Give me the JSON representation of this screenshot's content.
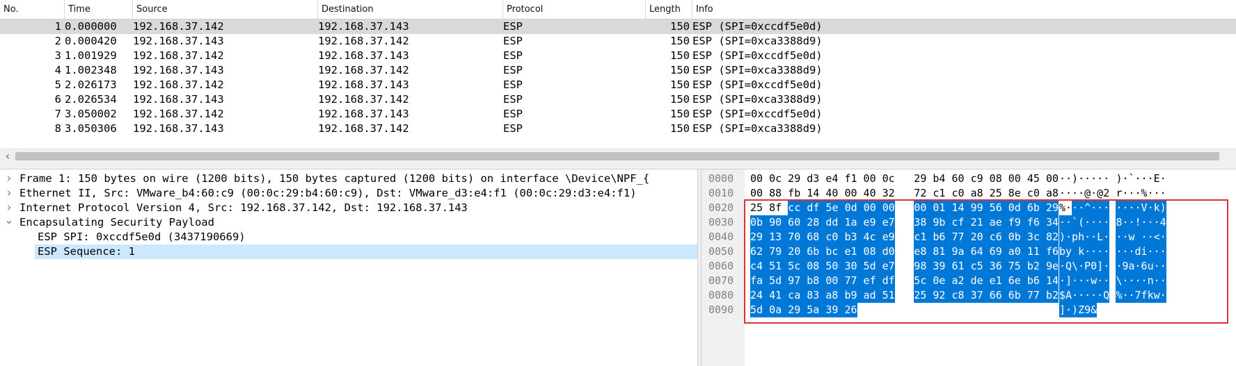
{
  "packet_list": {
    "columns": [
      "No.",
      "Time",
      "Source",
      "Destination",
      "Protocol",
      "Length",
      "Info"
    ],
    "rows": [
      {
        "no": "1",
        "time": "0.000000",
        "source": "192.168.37.142",
        "destination": "192.168.37.143",
        "protocol": "ESP",
        "length": "150",
        "info": "ESP (SPI=0xccdf5e0d)"
      },
      {
        "no": "2",
        "time": "0.000420",
        "source": "192.168.37.143",
        "destination": "192.168.37.142",
        "protocol": "ESP",
        "length": "150",
        "info": "ESP (SPI=0xca3388d9)"
      },
      {
        "no": "3",
        "time": "1.001929",
        "source": "192.168.37.142",
        "destination": "192.168.37.143",
        "protocol": "ESP",
        "length": "150",
        "info": "ESP (SPI=0xccdf5e0d)"
      },
      {
        "no": "4",
        "time": "1.002348",
        "source": "192.168.37.143",
        "destination": "192.168.37.142",
        "protocol": "ESP",
        "length": "150",
        "info": "ESP (SPI=0xca3388d9)"
      },
      {
        "no": "5",
        "time": "2.026173",
        "source": "192.168.37.142",
        "destination": "192.168.37.143",
        "protocol": "ESP",
        "length": "150",
        "info": "ESP (SPI=0xccdf5e0d)"
      },
      {
        "no": "6",
        "time": "2.026534",
        "source": "192.168.37.143",
        "destination": "192.168.37.142",
        "protocol": "ESP",
        "length": "150",
        "info": "ESP (SPI=0xca3388d9)"
      },
      {
        "no": "7",
        "time": "3.050002",
        "source": "192.168.37.142",
        "destination": "192.168.37.143",
        "protocol": "ESP",
        "length": "150",
        "info": "ESP (SPI=0xccdf5e0d)"
      },
      {
        "no": "8",
        "time": "3.050306",
        "source": "192.168.37.143",
        "destination": "192.168.37.142",
        "protocol": "ESP",
        "length": "150",
        "info": "ESP (SPI=0xca3388d9)"
      }
    ],
    "selected_row": "1",
    "scroll_left_icon": "chevron-left-icon"
  },
  "details": {
    "items": [
      {
        "text": "Frame 1: 150 bytes on wire (1200 bits), 150 bytes captured (1200 bits) on interface \\Device\\NPF_{",
        "icon": "chevron-right-icon",
        "expanded": false
      },
      {
        "text": "Ethernet II, Src: VMware_b4:60:c9 (00:0c:29:b4:60:c9), Dst: VMware_d3:e4:f1 (00:0c:29:d3:e4:f1)",
        "icon": "chevron-right-icon",
        "expanded": false
      },
      {
        "text": "Internet Protocol Version 4, Src: 192.168.37.142, Dst: 192.168.37.143",
        "icon": "chevron-right-icon",
        "expanded": false
      },
      {
        "text": "Encapsulating Security Payload",
        "icon": "chevron-down-icon",
        "expanded": true
      }
    ],
    "children": [
      {
        "text": "ESP SPI: 0xccdf5e0d (3437190669)",
        "selected": false
      },
      {
        "text": "ESP Sequence: 1",
        "selected": true
      }
    ]
  },
  "bytes": {
    "rows": [
      {
        "offset": "0000",
        "hex_a": "00 0c 29 d3 e4 f1 00 0c",
        "hex_b": "29 b4 60 c9 08 00 45 00",
        "ascii_a": "··)·····",
        "ascii_b": ")·`···E·",
        "hl_hex_a": "",
        "hl_hex_b": "",
        "hl_asc_a": "",
        "hl_asc_b": ""
      },
      {
        "offset": "0010",
        "hex_a": "00 88 fb 14 40 00 40 32",
        "hex_b": "72 c1 c0 a8 25 8e c0 a8",
        "ascii_a": "····@·@2",
        "ascii_b": "r···%···",
        "hl_hex_a": "",
        "hl_hex_b": "",
        "hl_asc_a": "",
        "hl_asc_b": ""
      },
      {
        "offset": "0020",
        "hex_a": "25 8f",
        "hex_b": "",
        "ascii_a": "%·",
        "ascii_b": "",
        "hl_hex_a": "cc df 5e 0d 00 00",
        "hl_hex_b": "00 01 14 99 56 0d 6b 29",
        "hl_asc_a": "··^···",
        "hl_asc_b": "····V·k)"
      },
      {
        "offset": "0030",
        "hex_a": "",
        "hex_b": "",
        "ascii_a": "",
        "ascii_b": "",
        "hl_hex_a": "0b 90 60 28 dd 1a e9 e7",
        "hl_hex_b": "38 9b cf 21 ae f9 f6 34",
        "hl_asc_a": "··`(····",
        "hl_asc_b": "8··!···4"
      },
      {
        "offset": "0040",
        "hex_a": "",
        "hex_b": "",
        "ascii_a": "",
        "ascii_b": "",
        "hl_hex_a": "29 13 70 68 c0 b3 4c e9",
        "hl_hex_b": "c1 b6 77 20 c6 0b 3c 82",
        "hl_asc_a": ")·ph··L·",
        "hl_asc_b": "··w ··<·"
      },
      {
        "offset": "0050",
        "hex_a": "",
        "hex_b": "",
        "ascii_a": "",
        "ascii_b": "",
        "hl_hex_a": "62 79 20 6b bc e1 08 d0",
        "hl_hex_b": "e8 81 9a 64 69 a0 11 f6",
        "hl_asc_a": "by k····",
        "hl_asc_b": "···di···"
      },
      {
        "offset": "0060",
        "hex_a": "",
        "hex_b": "",
        "ascii_a": "",
        "ascii_b": "",
        "hl_hex_a": "c4 51 5c 08 50 30 5d e7",
        "hl_hex_b": "98 39 61 c5 36 75 b2 9e",
        "hl_asc_a": "·Q\\·P0]·",
        "hl_asc_b": "·9a·6u··"
      },
      {
        "offset": "0070",
        "hex_a": "",
        "hex_b": "",
        "ascii_a": "",
        "ascii_b": "",
        "hl_hex_a": "fa 5d 97 b8 00 77 ef df",
        "hl_hex_b": "5c 0e a2 de e1 6e b6 14",
        "hl_asc_a": "·]···w··",
        "hl_asc_b": "\\····n··"
      },
      {
        "offset": "0080",
        "hex_a": "",
        "hex_b": "",
        "ascii_a": "",
        "ascii_b": "",
        "hl_hex_a": "24 41 ca 83 a8 b9 ad 51",
        "hl_hex_b": "25 92 c8 37 66 6b 77 b2",
        "hl_asc_a": "$A·····Q",
        "hl_asc_b": "%··7fkw·"
      },
      {
        "offset": "0090",
        "hex_a": "",
        "hex_b": "",
        "ascii_a": "",
        "ascii_b": "",
        "hl_hex_a": "5d 0a 29 5a 39 26",
        "hl_hex_b": "",
        "hl_asc_a": "]·)Z9&",
        "hl_asc_b": ""
      }
    ]
  },
  "colors": {
    "selected_row": "#d9d9d9",
    "detail_selected": "#cce8ff",
    "byte_highlight": "#0078d7",
    "annotation_box": "#e03030"
  }
}
